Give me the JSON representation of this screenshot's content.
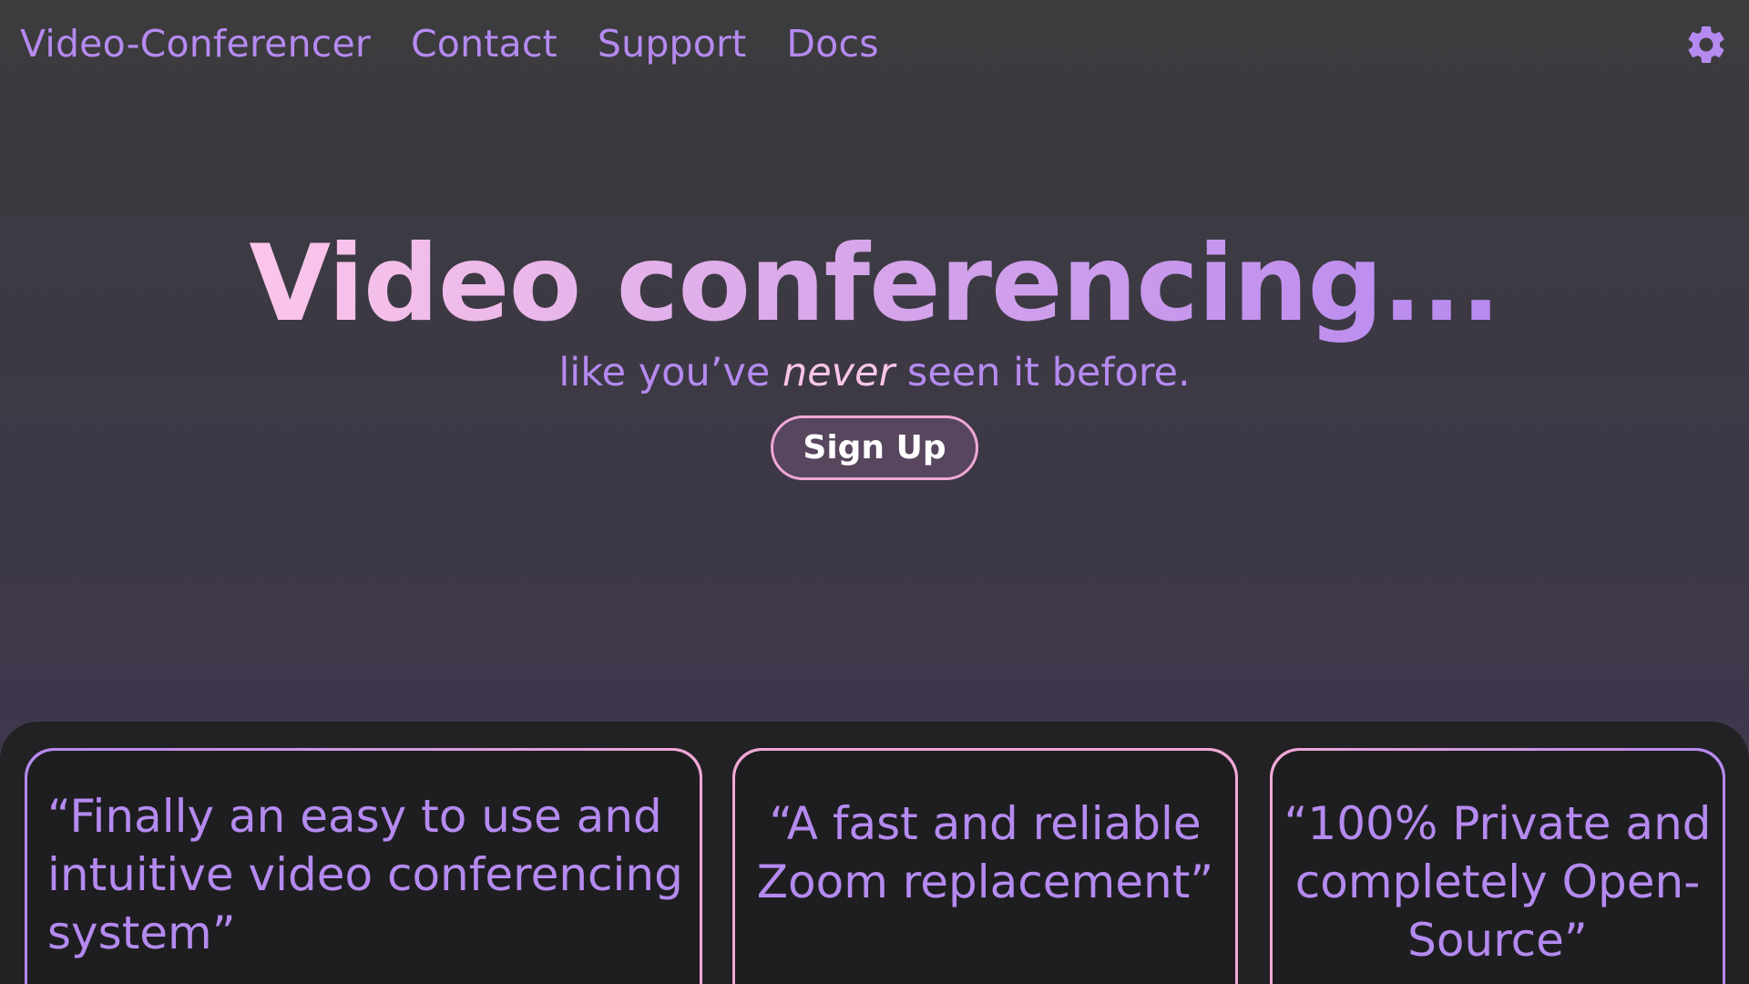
{
  "nav": {
    "brand": "Video-Conferencer",
    "links": [
      "Contact",
      "Support",
      "Docs"
    ],
    "settings_icon": "gear-icon"
  },
  "hero": {
    "title": "Video conferencing...",
    "subtitle_before": "like you’ve ",
    "subtitle_emphasis": "never",
    "subtitle_after": " seen it before.",
    "signup_label": "Sign Up"
  },
  "testimonials": [
    {
      "text": "“Finally an easy to use and intuitive video conferencing system”"
    },
    {
      "text": "“A fast and reliable Zoom replacement”"
    },
    {
      "text": "“100% Private and completely Open-Source”"
    }
  ],
  "colors": {
    "accent_purple": "#b58af0",
    "accent_pink": "#fcc6ea",
    "button_border": "#f0a8d6",
    "button_bg": "#57465e",
    "card_bg": "#1e1e20"
  }
}
